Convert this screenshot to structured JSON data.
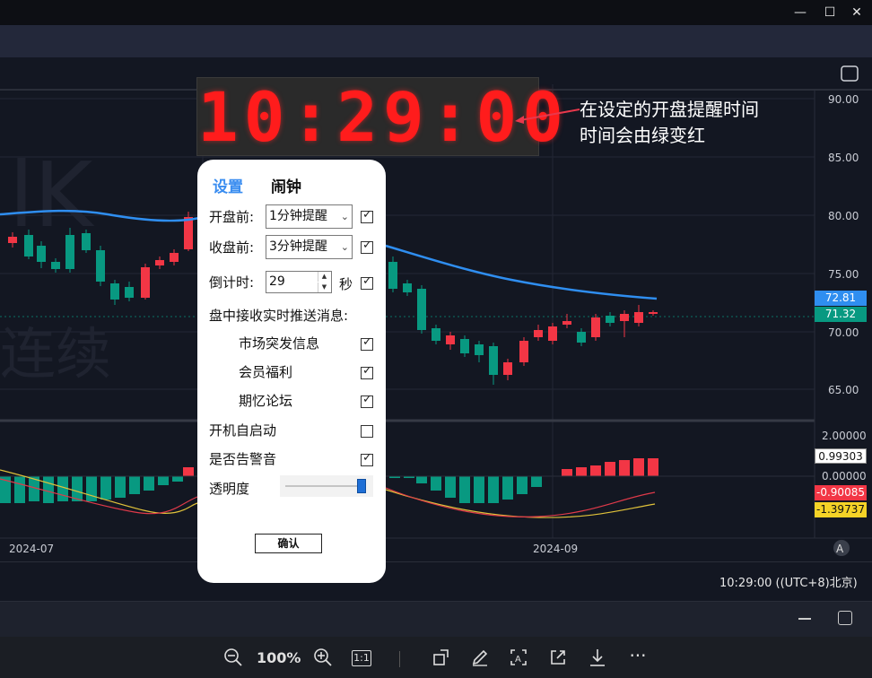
{
  "clock": {
    "time": "10:29:00"
  },
  "annotation": {
    "line1": "在设定的开盘提醒时间",
    "line2": "时间会由绿变红"
  },
  "dialog": {
    "tab_settings": "设置",
    "tab_alarm": "闹钟",
    "before_open_label": "开盘前:",
    "before_open_value": "1分钟提醒",
    "before_close_label": "收盘前:",
    "before_close_value": "3分钟提醒",
    "countdown_label": "倒计时:",
    "countdown_value": "29",
    "seconds_label": "秒",
    "push_label": "盘中接收实时推送消息:",
    "push_items": [
      "市场突发信息",
      "会员福利",
      "期忆论坛"
    ],
    "autostart_label": "开机自启动",
    "sound_label": "是否告警音",
    "opacity_label": "透明度",
    "opacity_level": 0.95,
    "confirm_label": "确认"
  },
  "chart": {
    "watermark_big": "lK",
    "watermark_small": "连续",
    "price_ticks": [
      "90.00",
      "85.00",
      "80.00",
      "75.00",
      "70.00",
      "65.00"
    ],
    "price_tag_ma": "72.81",
    "price_tag_last": "71.32",
    "macd_ticks": [
      "2.00000",
      "0.00000"
    ],
    "macd_tag_a": "0.99303",
    "macd_tag_b": "-0.90085",
    "macd_tag_c": "-1.39737",
    "x_ticks": [
      "2024-07",
      "2024-09"
    ],
    "auto_label": "A",
    "colors": {
      "up": "#f23645",
      "down": "#089981",
      "ma": "#2f8ef0"
    }
  },
  "status": {
    "time_text": "10:29:00 ((UTC+8)北京)"
  },
  "viewer": {
    "zoom": "100%",
    "fit": "1:1"
  },
  "window": {
    "minimize": "—",
    "maximize": "☐",
    "close": "✕"
  }
}
